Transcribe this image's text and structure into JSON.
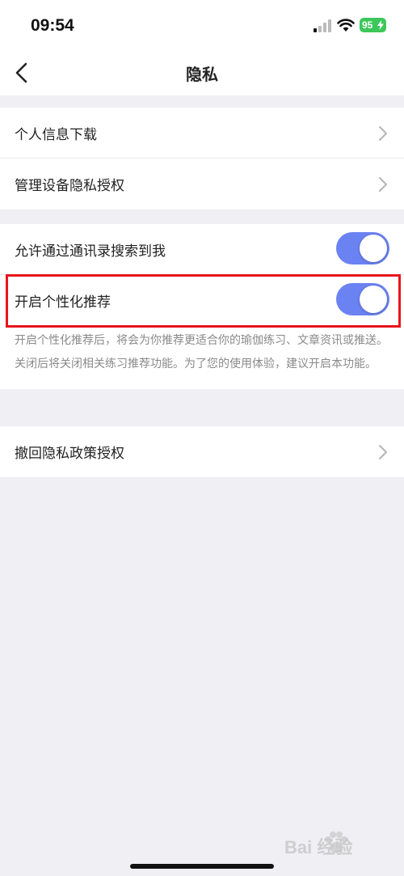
{
  "status_bar": {
    "time": "09:54",
    "battery": "95"
  },
  "nav": {
    "title": "隐私",
    "back_icon": "chevron-left-icon"
  },
  "group1": {
    "items": [
      {
        "label": "个人信息下载"
      },
      {
        "label": "管理设备隐私授权"
      }
    ]
  },
  "group2": {
    "contacts_search": {
      "label": "允许通过通讯录搜索到我",
      "on": true
    },
    "personalized": {
      "label": "开启个性化推荐",
      "on": true
    },
    "desc_1": "开启个性化推荐后，将会为你推荐更适合你的瑜伽练习、文章资讯或推送。",
    "desc_2": "关闭后将关闭相关练习推荐功能。为了您的使用体验，建议开启本功能。"
  },
  "group3": {
    "items": [
      {
        "label": "撤回隐私政策授权"
      }
    ]
  },
  "watermark": "Bai 经验",
  "colors": {
    "toggle_on": "#6b82f2",
    "highlight": "#e8141b",
    "battery": "#3cc75a",
    "background": "#efeff4"
  }
}
